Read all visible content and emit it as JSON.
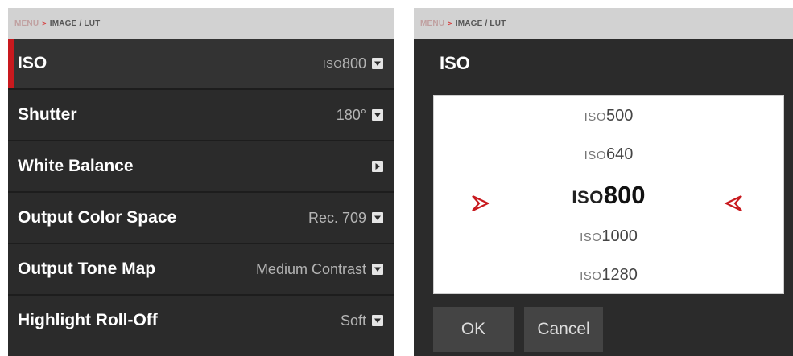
{
  "breadcrumb": {
    "menu": "MENU",
    "separator": ">",
    "path": "IMAGE / LUT"
  },
  "menu": {
    "items": [
      {
        "label": "ISO",
        "value_prefix": "ISO",
        "value": "800",
        "icon": "chevron-down-icon"
      },
      {
        "label": "Shutter",
        "value": "180°",
        "icon": "chevron-down-icon"
      },
      {
        "label": "White Balance",
        "value": "",
        "icon": "chevron-right-icon"
      },
      {
        "label": "Output Color Space",
        "value": "Rec. 709",
        "icon": "chevron-down-icon"
      },
      {
        "label": "Output Tone Map",
        "value": "Medium Contrast",
        "icon": "chevron-down-icon"
      },
      {
        "label": "Highlight Roll-Off",
        "value": "Soft",
        "icon": "chevron-down-icon"
      }
    ]
  },
  "dialog": {
    "title": "ISO",
    "options": [
      {
        "prefix": "ISO",
        "value": "500"
      },
      {
        "prefix": "ISO",
        "value": "640"
      },
      {
        "prefix": "ISO",
        "value": "800"
      },
      {
        "prefix": "ISO",
        "value": "1000"
      },
      {
        "prefix": "ISO",
        "value": "1280"
      }
    ],
    "selected_index": 2,
    "ok_label": "OK",
    "cancel_label": "Cancel"
  },
  "colors": {
    "accent_red": "#c8191e",
    "panel_bg": "#2b2b2b",
    "breadcrumb_bg": "#d2d2d2",
    "button_bg": "#444444"
  }
}
